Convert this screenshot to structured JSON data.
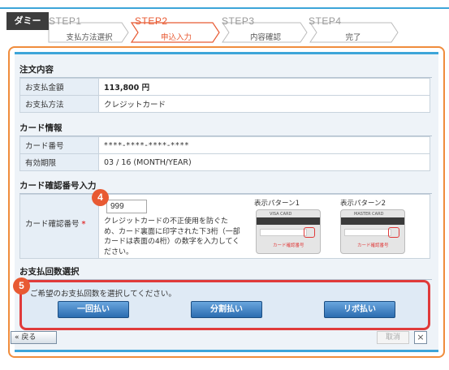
{
  "brand_label": "ダミー",
  "steps": [
    {
      "num": "STEP1",
      "label": "支払方法選択"
    },
    {
      "num": "STEP2",
      "label": "申込入力"
    },
    {
      "num": "STEP3",
      "label": "内容確認"
    },
    {
      "num": "STEP4",
      "label": "完了"
    }
  ],
  "active_step": 2,
  "order": {
    "title": "注文内容",
    "rows": [
      {
        "label": "お支払金額",
        "value": "113,800 円"
      },
      {
        "label": "お支払方法",
        "value": "クレジットカード"
      }
    ]
  },
  "card_info": {
    "title": "カード情報",
    "rows": [
      {
        "label": "カード番号",
        "value": "****-****-****-****"
      },
      {
        "label": "有効期限",
        "value": "03 / 16 (MONTH/YEAR)"
      }
    ]
  },
  "cvv": {
    "title": "カード確認番号入力",
    "label": "カード確認番号",
    "required_mark": "*",
    "value": "999",
    "help": "クレジットカードの不正使用を防ぐため、カード裏面に印字された下3桁（一部カードは表面の4桁）の数字を入力してください。",
    "pattern1_label": "表示パターン1",
    "pattern2_label": "表示パターン2",
    "card_caption": "カード確認番号"
  },
  "payment": {
    "title": "お支払回数選択",
    "prompt": "ご希望のお支払回数を選択してください。",
    "buttons": [
      "一回払い",
      "分割払い",
      "リボ払い"
    ]
  },
  "badges": {
    "cvv": "4",
    "payment": "5"
  },
  "footer": {
    "back": "戻る",
    "back_icon": "double-chevron-left-icon",
    "cancel": "取消",
    "close": "×"
  },
  "colors": {
    "accent_orange": "#e85a33",
    "highlight_red": "#e03a3a",
    "step_blue": "#3da5d9",
    "button_blue": "#2b6cb0"
  }
}
